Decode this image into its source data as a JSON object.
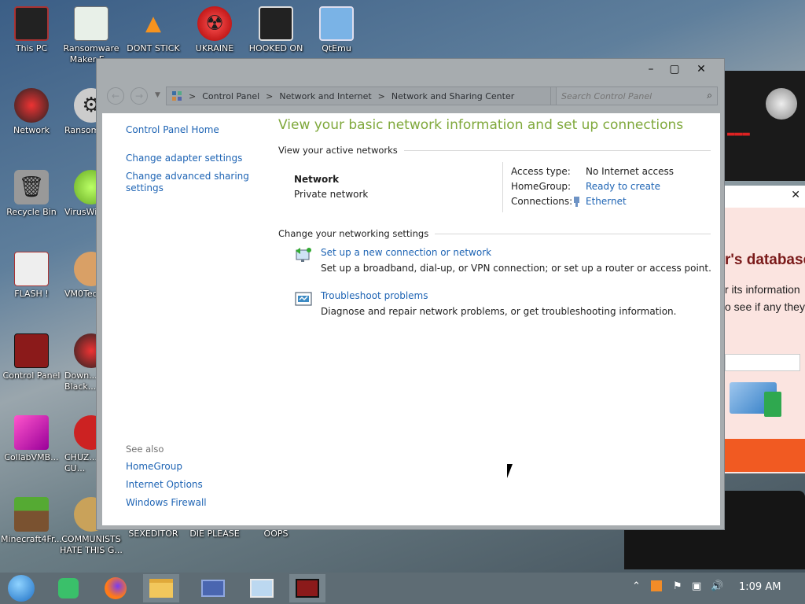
{
  "desktop": {
    "icons": [
      {
        "label": "This PC"
      },
      {
        "label": "Ransomware Maker E..."
      },
      {
        "label": "DONT STICK"
      },
      {
        "label": "UKRAINE"
      },
      {
        "label": "HOOKED ON"
      },
      {
        "label": "QtEmu"
      },
      {
        "label": "Network"
      },
      {
        "label": "Ransom..."
      },
      {
        "label": "Recycle Bin"
      },
      {
        "label": "VirusWi..."
      },
      {
        "label": "FLASH !"
      },
      {
        "label": "VM0Tec..."
      },
      {
        "label": "Control Panel"
      },
      {
        "label": "Down... Black..."
      },
      {
        "label": "CollabVMB..."
      },
      {
        "label": "CHUZ... CU..."
      },
      {
        "label": "Minecraft4Fr..."
      },
      {
        "label": "COMMUNISTS HATE THIS G..."
      },
      {
        "label": "SEXEDITOR"
      },
      {
        "label": "DIE PLEASE"
      },
      {
        "label": "OOPS"
      }
    ]
  },
  "background_window": {
    "heading": "r's database",
    "line1": "r its information",
    "line2": "o see if any they"
  },
  "window": {
    "controls": {
      "minimize": "–",
      "maximize": "▢",
      "close": "✕"
    },
    "address": {
      "breadcrumbs": [
        "Control Panel",
        "Network and Internet",
        "Network and Sharing Center"
      ],
      "separator": ">",
      "search_placeholder": "Search Control Panel"
    },
    "sidebar": {
      "home": "Control Panel Home",
      "links": [
        "Change adapter settings",
        "Change advanced sharing settings"
      ],
      "see_also_label": "See also",
      "see_also": [
        "HomeGroup",
        "Internet Options",
        "Windows Firewall"
      ]
    },
    "main": {
      "title": "View your basic network information and set up connections",
      "active_networks_label": "View your active networks",
      "network_name": "Network",
      "network_type": "Private network",
      "access_type_label": "Access type:",
      "access_type_value": "No Internet access",
      "homegroup_label": "HomeGroup:",
      "homegroup_value": "Ready to create",
      "connections_label": "Connections:",
      "connections_value": "Ethernet",
      "change_settings_label": "Change your networking settings",
      "actions": [
        {
          "link": "Set up a new connection or network",
          "desc": "Set up a broadband, dial-up, or VPN connection; or set up a router or access point."
        },
        {
          "link": "Troubleshoot problems",
          "desc": "Diagnose and repair network problems, or get troubleshooting information."
        }
      ]
    }
  },
  "taskbar": {
    "clock": "1:09 AM"
  }
}
